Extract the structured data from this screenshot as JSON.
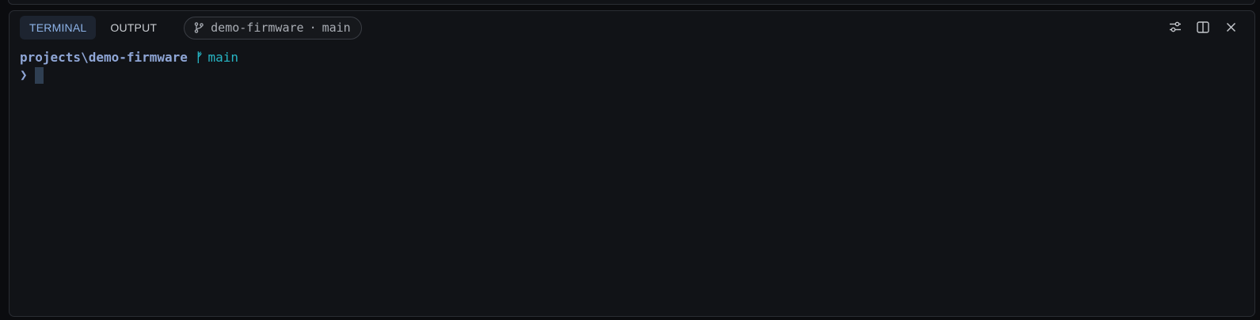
{
  "tabs": [
    {
      "label": "TERMINAL",
      "active": true
    },
    {
      "label": "OUTPUT",
      "active": false
    }
  ],
  "context_chip": {
    "icon": "git-branch-icon",
    "project": "demo-firmware",
    "separator": "·",
    "branch": "main"
  },
  "actions": {
    "settings_icon": "sliders-icon",
    "split_icon": "split-pane-icon",
    "close_icon": "close-icon"
  },
  "terminal": {
    "path": "projects\\demo-firmware",
    "branch_glyph": "ᚠ",
    "branch": "main",
    "prompt": "❯"
  },
  "colors": {
    "panel_bg": "#111317",
    "accent": "#8db3e8",
    "path": "#8fa6d6",
    "branch": "#27b5c4",
    "cursor": "#2f3f52"
  }
}
